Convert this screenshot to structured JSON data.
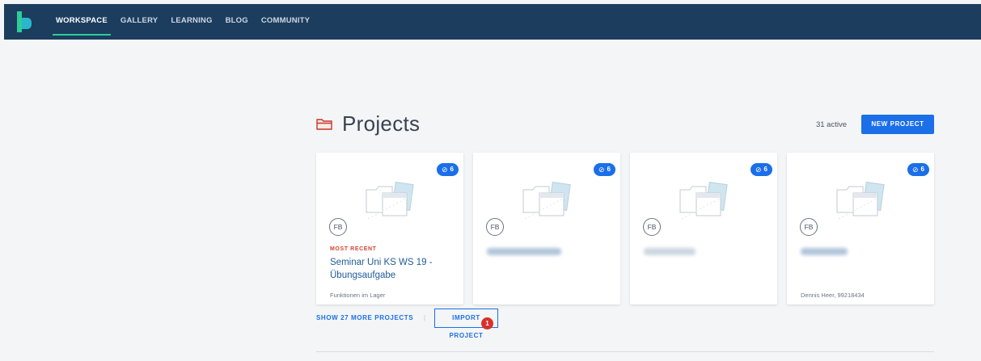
{
  "nav": {
    "items": [
      {
        "label": "WORKSPACE",
        "active": true
      },
      {
        "label": "GALLERY",
        "active": false
      },
      {
        "label": "LEARNING",
        "active": false
      },
      {
        "label": "BLOG",
        "active": false
      },
      {
        "label": "COMMUNITY",
        "active": false
      }
    ]
  },
  "projects": {
    "title": "Projects",
    "active_count": "31 active",
    "new_button": "NEW PROJECT",
    "cards": [
      {
        "avatar": "FB",
        "badge": "6",
        "tag": "MOST RECENT",
        "title": "Seminar Uni KS WS 19 - Übungsaufgabe",
        "subtitle": "Funktionen im Lager"
      },
      {
        "avatar": "FB",
        "badge": "6",
        "tag": "",
        "title": "",
        "subtitle": ""
      },
      {
        "avatar": "FB",
        "badge": "6",
        "tag": "",
        "title": "",
        "subtitle": ""
      },
      {
        "avatar": "FB",
        "badge": "6",
        "tag": "",
        "title": "",
        "subtitle": "Dennis Heer, 99218434"
      }
    ],
    "show_more": "SHOW 27 MORE PROJECTS",
    "separator": "|",
    "import": "IMPORT PROJECT",
    "marker": "1"
  },
  "colors": {
    "nav_bg": "#1c3d5e",
    "accent": "#1b6fe8",
    "active_underline": "#2ecc9a",
    "most_recent": "#d3462e",
    "marker": "#d9302b"
  },
  "icons": {
    "logo": "app-logo",
    "folder": "folder-icon",
    "badge": "link-icon",
    "card_image": "folder-illustration-icon"
  }
}
